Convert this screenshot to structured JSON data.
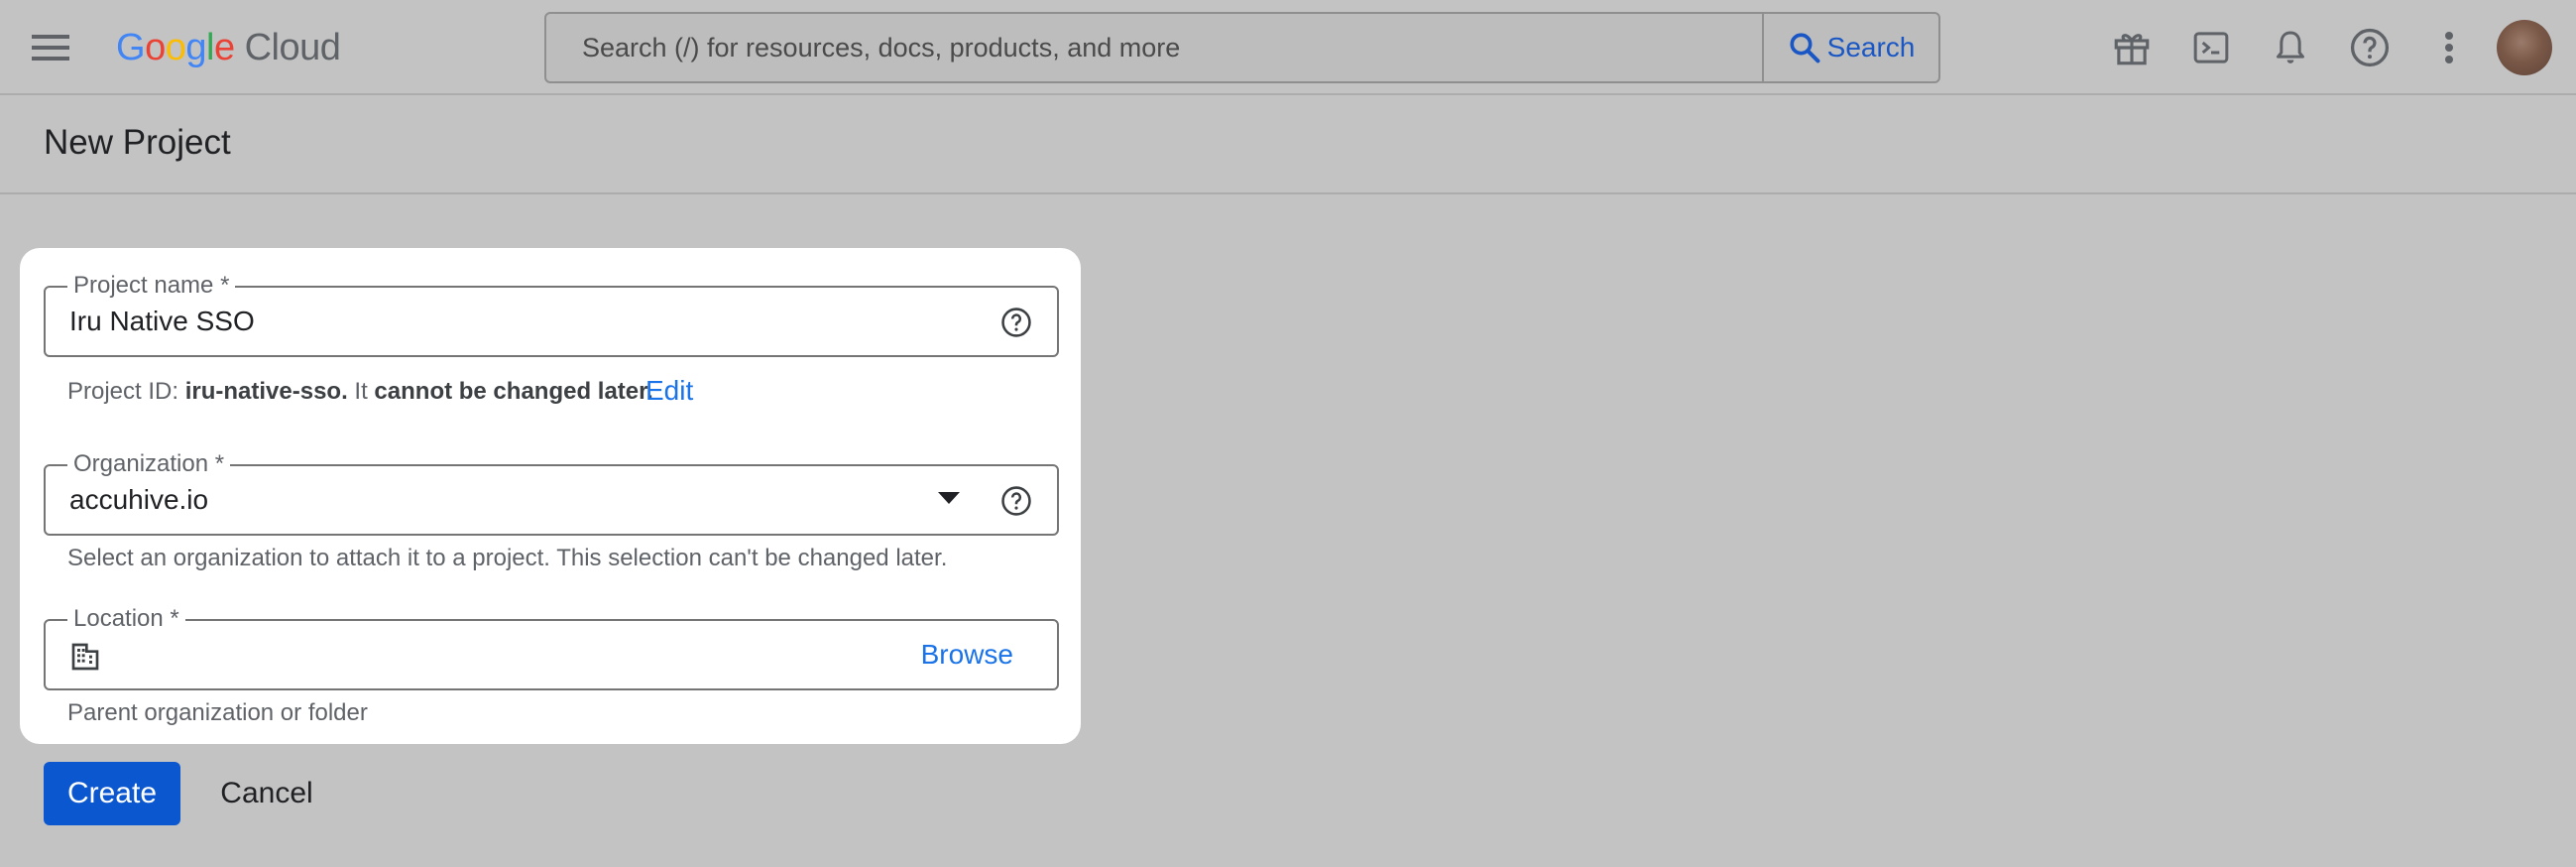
{
  "header": {
    "logo_letters": [
      "G",
      "o",
      "o",
      "g",
      "l",
      "e"
    ],
    "logo_product": "Cloud",
    "search": {
      "placeholder": "Search (/) for resources, docs, products, and more",
      "button_label": "Search"
    },
    "icons": [
      "menu-icon",
      "gift-icon",
      "cloud-shell-icon",
      "notifications-icon",
      "help-icon",
      "more-vert-icon",
      "avatar"
    ]
  },
  "page": {
    "title": "New Project"
  },
  "form": {
    "project_name": {
      "label": "Project name *",
      "value": "Iru Native SSO",
      "hint_prefix": "Project ID: ",
      "hint_id": "iru-native-sso.",
      "hint_mid": " It ",
      "hint_bold": "cannot be changed later.",
      "edit_label": "Edit"
    },
    "organization": {
      "label": "Organization *",
      "value": "accuhive.io",
      "hint": "Select an organization to attach it to a project. This selection can't be changed later."
    },
    "location": {
      "label": "Location *",
      "browse_label": "Browse",
      "hint": "Parent organization or folder"
    }
  },
  "actions": {
    "create_label": "Create",
    "cancel_label": "Cancel"
  },
  "colors": {
    "primary": "#0b57d0",
    "link": "#1a73e8",
    "overlay": "#c3c3c3"
  }
}
